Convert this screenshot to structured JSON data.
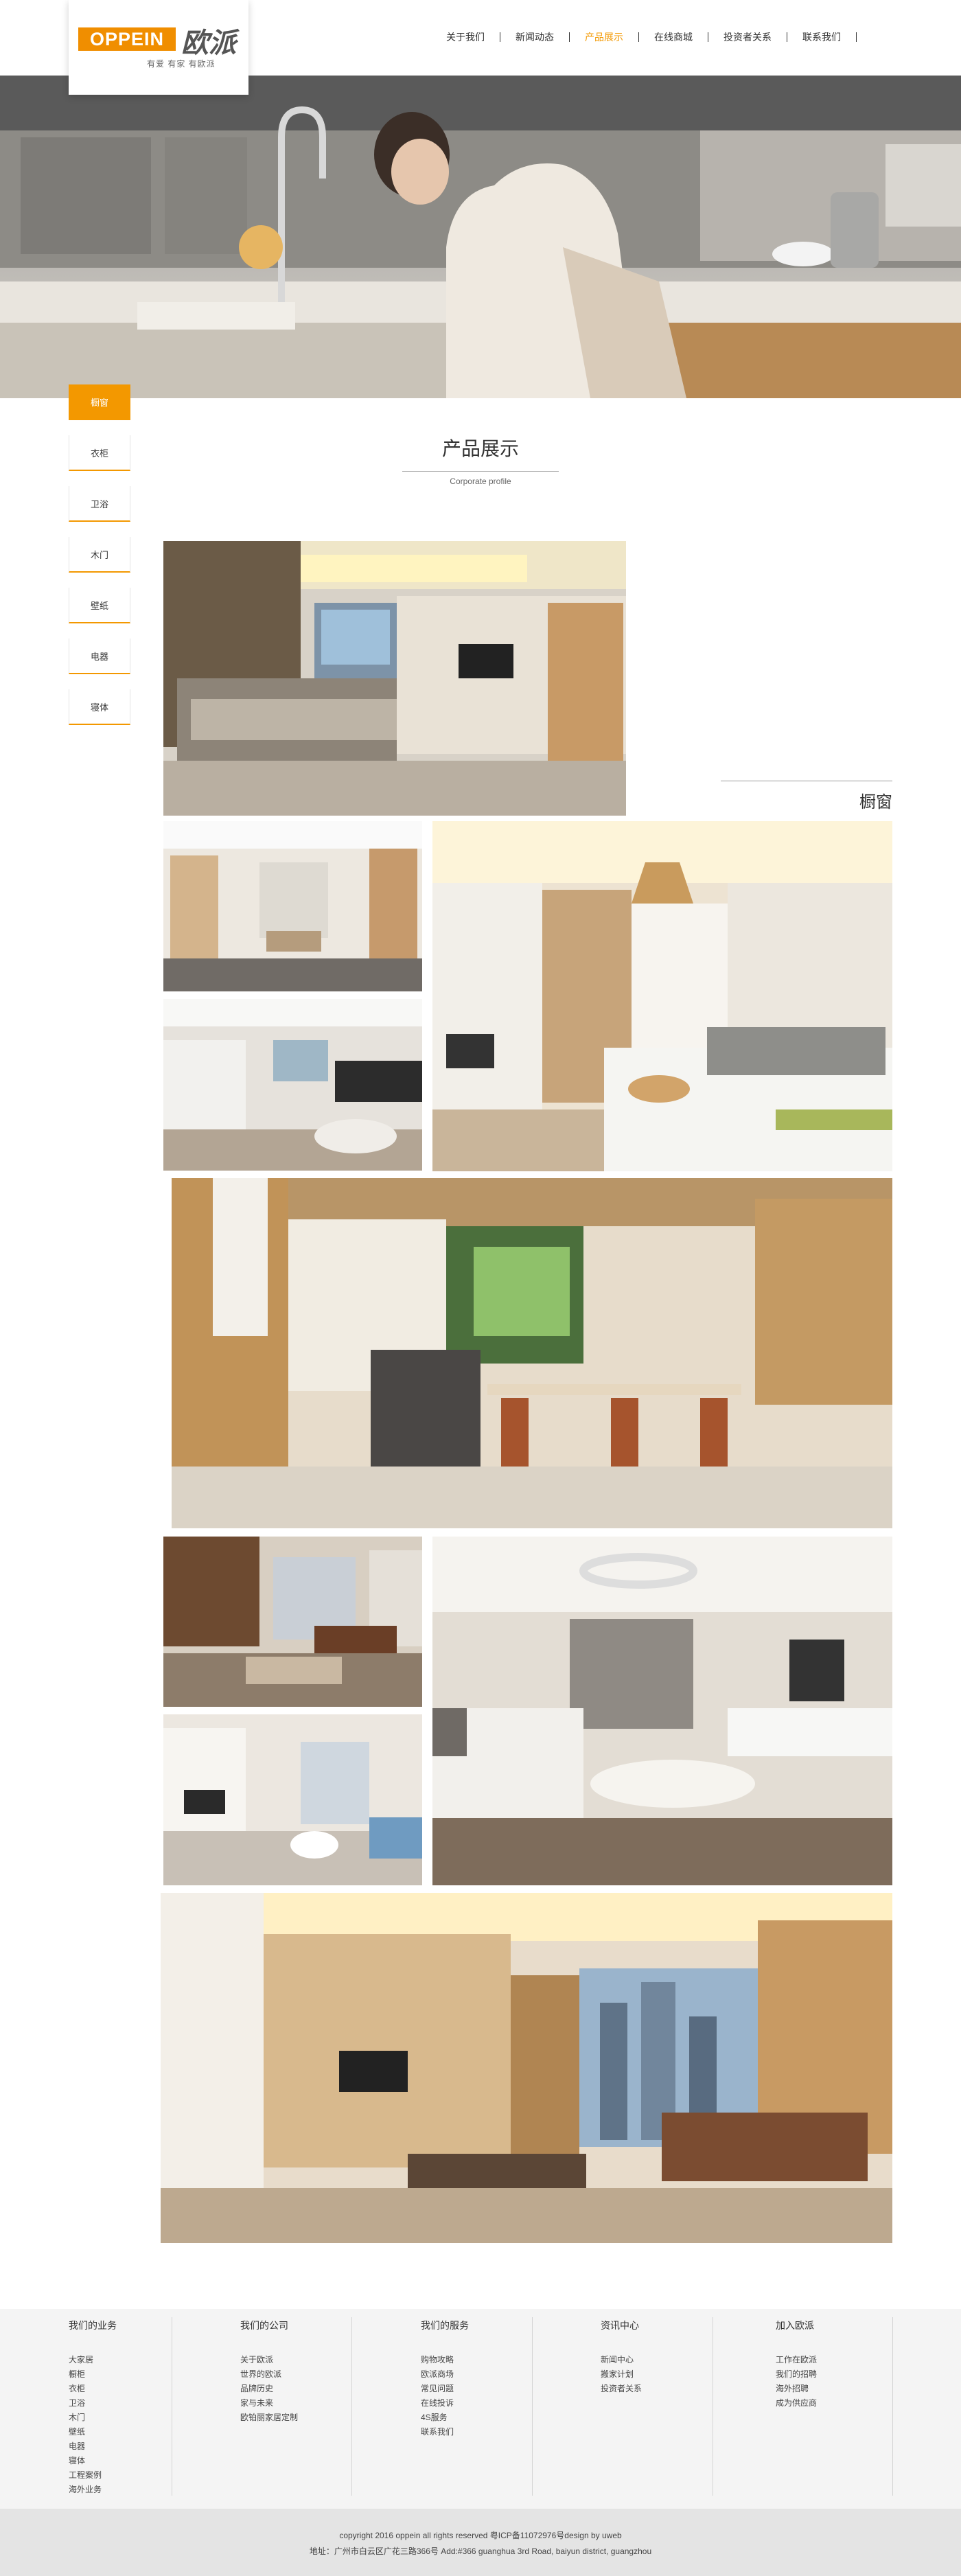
{
  "brand": {
    "logo_en": "OPPEIN",
    "logo_cn": "欧派",
    "tagline": "有爱 有家 有欧派"
  },
  "nav": [
    {
      "label": "关于我们"
    },
    {
      "label": "新闻动态"
    },
    {
      "label": "产品展示"
    },
    {
      "label": "在线商城"
    },
    {
      "label": "投资者关系"
    },
    {
      "label": "联系我们"
    }
  ],
  "sidebar": [
    {
      "label": "橱窗"
    },
    {
      "label": "衣柜"
    },
    {
      "label": "卫浴"
    },
    {
      "label": "木门"
    },
    {
      "label": "壁纸"
    },
    {
      "label": "电器"
    },
    {
      "label": "寝体"
    }
  ],
  "section": {
    "title": "产品展示",
    "subtitle": "Corporate profile"
  },
  "gallery": {
    "caption": "橱窗"
  },
  "footer": {
    "columns": [
      {
        "title": "我们的业务",
        "links": [
          "大家居",
          "橱柜",
          "衣柜",
          "卫浴",
          "木门",
          "壁纸",
          "电器",
          "寝体",
          "工程案例",
          "海外业务"
        ]
      },
      {
        "title": "我们的公司",
        "links": [
          "关于欧派",
          "世界的欧派",
          "品牌历史",
          "家与未来",
          "欧铂丽家居定制"
        ]
      },
      {
        "title": "我们的服务",
        "links": [
          "购物攻略",
          "欧派商场",
          "常见问题",
          "在线投诉",
          "4S服务",
          "联系我们"
        ]
      },
      {
        "title": "资讯中心",
        "links": [
          "新闻中心",
          "搬家计划",
          "投资者关系"
        ]
      },
      {
        "title": "加入欧派",
        "links": [
          "工作在欧派",
          "我们的招聘",
          "海外招聘",
          "成为供应商"
        ]
      }
    ],
    "copyright": "copyright 2016 oppein all rights reserved 粤ICP备11072976号design by uweb",
    "address": "地址：广州市白云区广花三路366号 Add:#366 guanghua 3rd Road, baiyun district, guangzhou"
  },
  "colors": {
    "accent": "#f39800",
    "footer_bg": "#f4f4f4",
    "copyright_bg": "#e4e4e4"
  }
}
